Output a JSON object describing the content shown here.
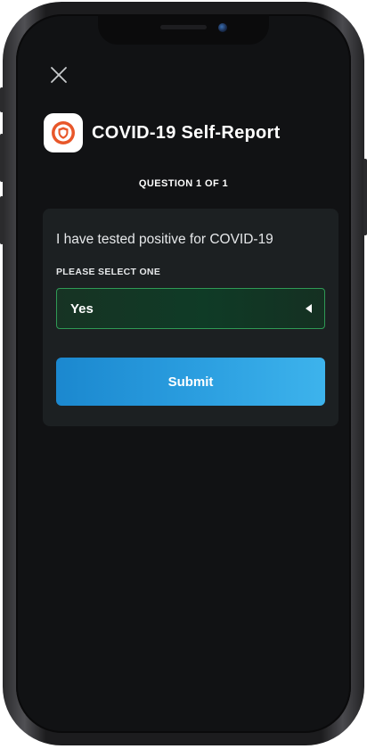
{
  "header": {
    "close_icon": "close-icon",
    "app_icon": "shield-icon",
    "title": "COVID-19 Self-Report"
  },
  "question": {
    "counter": "QUESTION 1 OF 1",
    "text": "I have tested positive for COVID-19",
    "select_label": "PLEASE SELECT ONE",
    "selected_value": "Yes"
  },
  "actions": {
    "submit_label": "Submit"
  },
  "colors": {
    "background": "#111214",
    "card": "#1c2022",
    "select_border": "#2f9a55",
    "submit_start": "#1b88cf",
    "submit_end": "#3db3ec",
    "shield_orange": "#e8572a"
  }
}
